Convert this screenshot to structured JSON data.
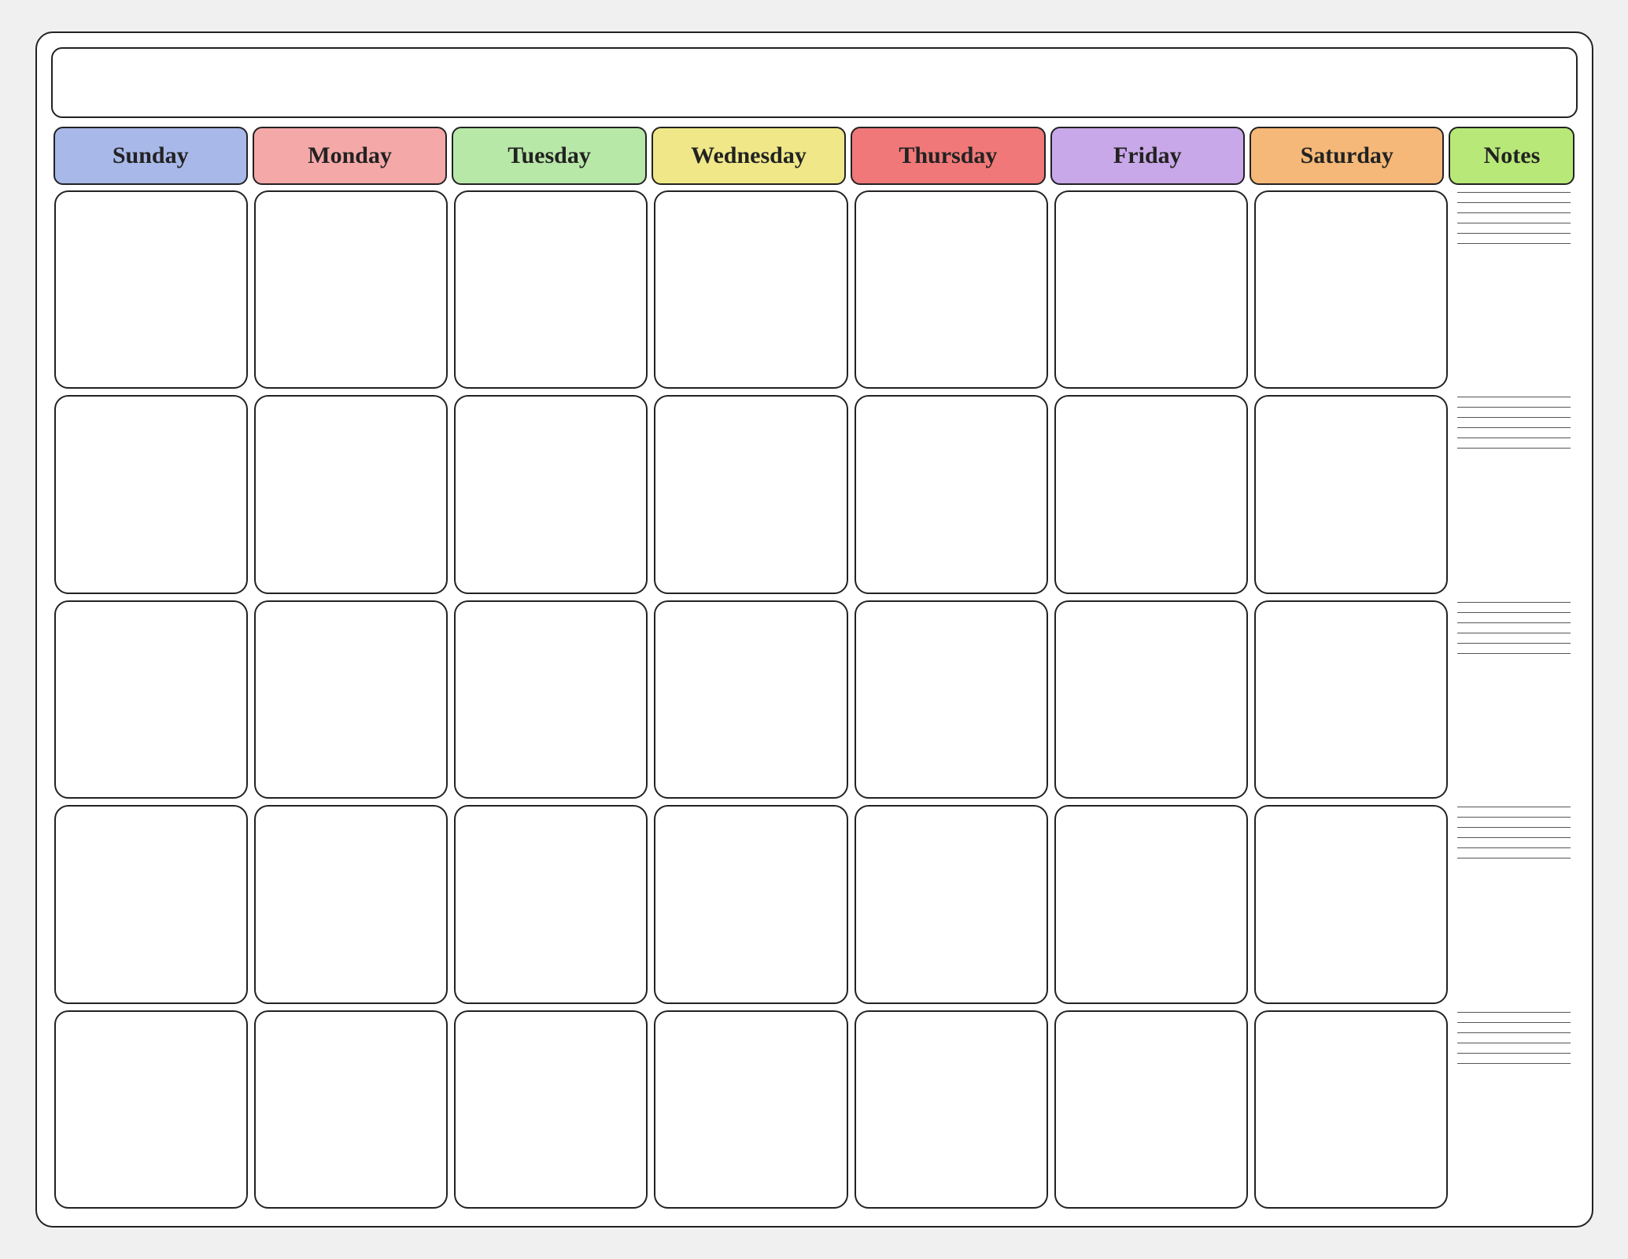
{
  "calendar": {
    "title": "",
    "headers": [
      {
        "key": "sunday",
        "label": "Sunday",
        "class": "sunday"
      },
      {
        "key": "monday",
        "label": "Monday",
        "class": "monday"
      },
      {
        "key": "tuesday",
        "label": "Tuesday",
        "class": "tuesday"
      },
      {
        "key": "wednesday",
        "label": "Wednesday",
        "class": "wednesday"
      },
      {
        "key": "thursday",
        "label": "Thursday",
        "class": "thursday"
      },
      {
        "key": "friday",
        "label": "Friday",
        "class": "friday"
      },
      {
        "key": "saturday",
        "label": "Saturday",
        "class": "saturday"
      },
      {
        "key": "notes",
        "label": "Notes",
        "class": "notes"
      }
    ],
    "rows": 5,
    "notes_lines": 30
  }
}
